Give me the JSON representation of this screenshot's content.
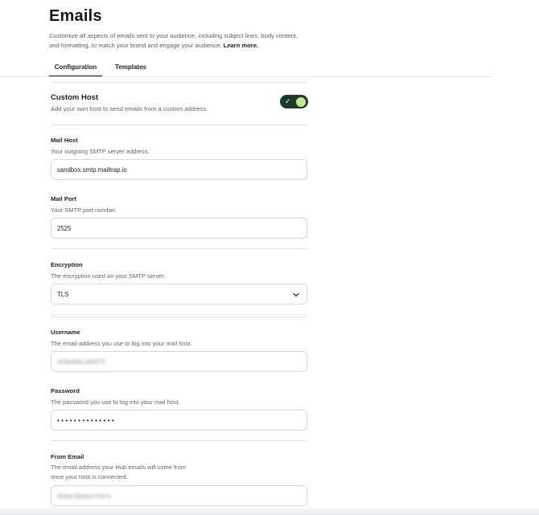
{
  "page": {
    "title": "Emails",
    "description": "Customize all aspects of emails sent to your audience, including subject lines, body content, and formatting, to match your brand and engage your audience.",
    "learn_more": "Learn more."
  },
  "tabs": [
    {
      "label": "Configuration",
      "active": true
    },
    {
      "label": "Templates",
      "active": false
    }
  ],
  "custom_host": {
    "title": "Custom Host",
    "description": "Add your own host to send emails from a custom address.",
    "enabled": true,
    "toggle_color": "#1d3a2e",
    "knob_color": "#c6e58f"
  },
  "mail_host": {
    "label": "Mail Host",
    "description": "Your outgoing SMTP server address.",
    "value": "sandbox.smtp.mailtrap.io"
  },
  "mail_port": {
    "label": "Mail Port",
    "description": "Your SMTP port number.",
    "value": "2525"
  },
  "encryption": {
    "label": "Encryption",
    "description": "The encryption used on your SMTP server.",
    "value": "TLS"
  },
  "username": {
    "label": "Username",
    "description": "The email address you use to log into your mail host.",
    "value": "dc9b4a6cadd470"
  },
  "password": {
    "label": "Password",
    "description": "The password you use to log into your mail host.",
    "value": "••••••••••••••"
  },
  "from_email": {
    "label": "From Email",
    "description": "The email address your Hub emails will come from once your host is connected.",
    "value": "lorikar@searchia.io"
  }
}
